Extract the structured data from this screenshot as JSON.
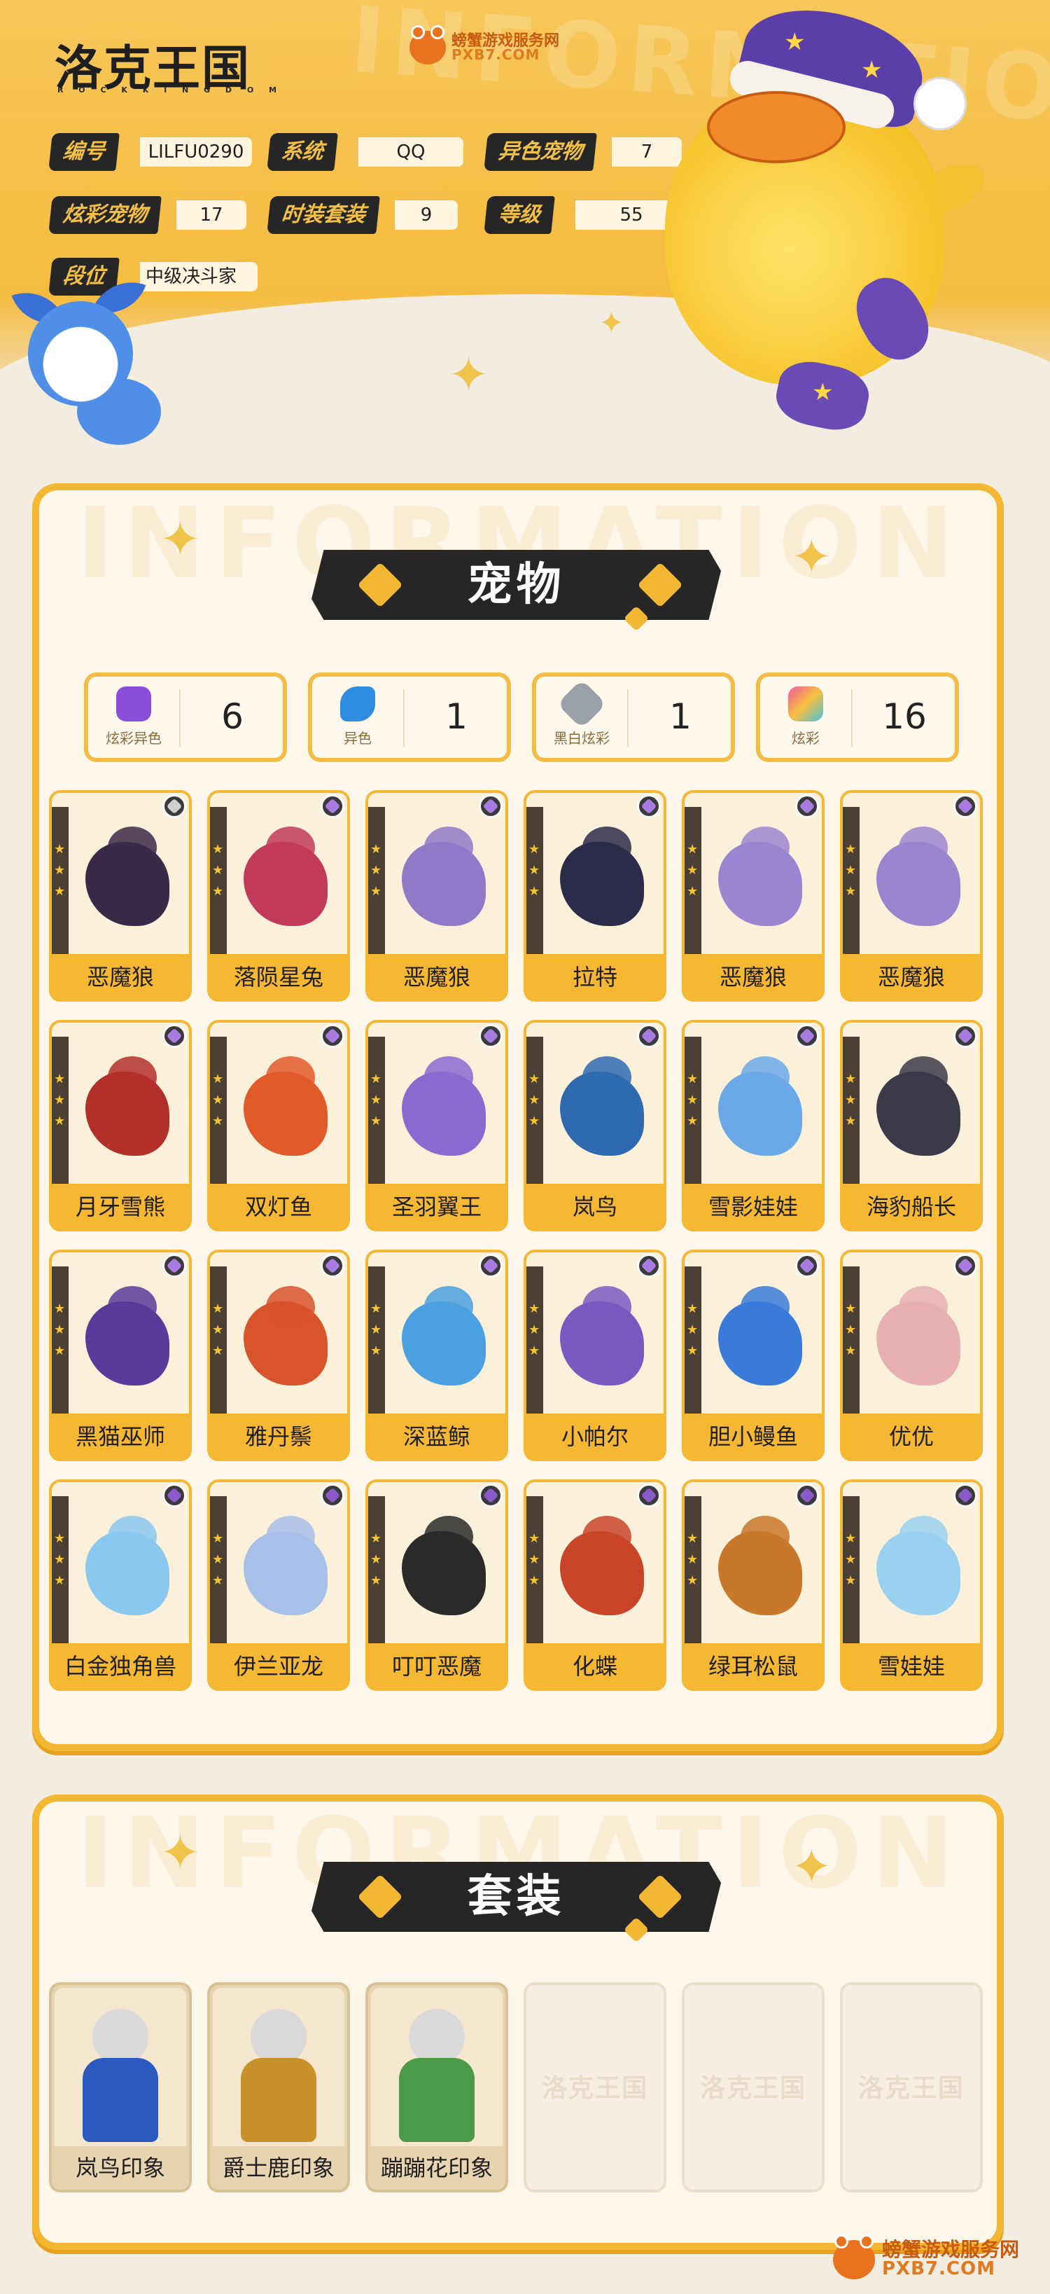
{
  "brand": {
    "logo": "洛克王国",
    "logo_sub": "R O C K K I N G D O M",
    "site_name": "螃蟹游戏服务网",
    "site_url": "PXB7.COM"
  },
  "watermark_text": "INFORMATION",
  "account": {
    "fields": [
      {
        "label": "编号",
        "value": "LILFU0290"
      },
      {
        "label": "系统",
        "value": "QQ"
      },
      {
        "label": "异色宠物",
        "value": "7"
      },
      {
        "label": "炫彩宠物",
        "value": "17"
      },
      {
        "label": "时装套装",
        "value": "9"
      },
      {
        "label": "等级",
        "value": "55"
      },
      {
        "label": "段位",
        "value": "中级决斗家"
      }
    ]
  },
  "pets_section": {
    "title": "宠物",
    "stats": [
      {
        "label": "炫彩异色",
        "value": "6",
        "icon": "rainbow-star-icon",
        "color": "#8a4fd8"
      },
      {
        "label": "异色",
        "value": "1",
        "icon": "blue-boomerang-icon",
        "color": "#2d8de0"
      },
      {
        "label": "黑白炫彩",
        "value": "1",
        "icon": "silver-diamond-icon",
        "color": "#9aa0a8"
      },
      {
        "label": "炫彩",
        "value": "16",
        "icon": "colorful-star-icon",
        "color": "#f05aa0"
      }
    ],
    "pets": [
      {
        "name": "恶魔狼",
        "color": "#3a2a4a",
        "arc": "#f3b733",
        "badge": "#cfcfcf"
      },
      {
        "name": "落陨星兔",
        "color": "#c23a5a",
        "arc": "#4a8fe0",
        "badge": "#a77be0"
      },
      {
        "name": "恶魔狼",
        "color": "#8f7ac8",
        "arc": "#4a8fe0",
        "badge": "#a77be0"
      },
      {
        "name": "拉特",
        "color": "#2b2b4a",
        "arc": "#4a8fe0",
        "badge": "#a77be0"
      },
      {
        "name": "恶魔狼",
        "color": "#9a86d0",
        "arc": "#4a8fe0",
        "badge": "#a77be0"
      },
      {
        "name": "恶魔狼",
        "color": "#9a86d0",
        "arc": "#4a8fe0",
        "badge": "#a77be0"
      },
      {
        "name": "月牙雪熊",
        "color": "#b3302a",
        "arc": "#4a8fe0",
        "badge": "#a77be0"
      },
      {
        "name": "双灯鱼",
        "color": "#e25a2a",
        "arc": "#4a8fe0",
        "badge": "#a77be0"
      },
      {
        "name": "圣羽翼王",
        "color": "#8a6ad0",
        "arc": "#f3b733",
        "badge": "#a77be0"
      },
      {
        "name": "岚鸟",
        "color": "#2f6ab0",
        "arc": "#5ad0c8",
        "badge": "#a77be0"
      },
      {
        "name": "雪影娃娃",
        "color": "#6aa8e8",
        "arc": "#5ad0c8",
        "badge": "#a77be0"
      },
      {
        "name": "海豹船长",
        "color": "#3a3a48",
        "arc": "#5ad0c8",
        "badge": "#a77be0"
      },
      {
        "name": "黑猫巫师",
        "color": "#5a3a9a",
        "arc": "#5ad0c8",
        "badge": "#a77be0"
      },
      {
        "name": "雅丹鬃",
        "color": "#d8542a",
        "arc": "#5ad0c8",
        "badge": "#a77be0"
      },
      {
        "name": "深蓝鲸",
        "color": "#4aa0e0",
        "arc": "#5ad0c8",
        "badge": "#a77be0"
      },
      {
        "name": "小帕尔",
        "color": "#7a5ac0",
        "arc": "#5ad0c8",
        "badge": "#a77be0"
      },
      {
        "name": "胆小鳗鱼",
        "color": "#3a7ad8",
        "arc": "#5ad0c8",
        "badge": "#a77be0"
      },
      {
        "name": "优优",
        "color": "#e8b0b0",
        "arc": "#5ad0c8",
        "badge": "#a77be0"
      },
      {
        "name": "白金独角兽",
        "color": "#8ac8f0",
        "arc": "#5ad0c8",
        "badge": "#8a5ac8"
      },
      {
        "name": "伊兰亚龙",
        "color": "#a8c0e8",
        "arc": "#5ad0c8",
        "badge": "#8a5ac8"
      },
      {
        "name": "叮叮恶魔",
        "color": "#2a2a2a",
        "arc": "#5ad0c8",
        "badge": "#8a5ac8"
      },
      {
        "name": "化蝶",
        "color": "#c8452a",
        "arc": "#5ad0c8",
        "badge": "#8a5ac8"
      },
      {
        "name": "绿耳松鼠",
        "color": "#c8782a",
        "arc": "#5ad0c8",
        "badge": "#8a5ac8"
      },
      {
        "name": "雪娃娃",
        "color": "#9ad0f0",
        "arc": "#5ad0c8",
        "badge": "#8a5ac8"
      }
    ]
  },
  "outfits_section": {
    "title": "套装",
    "outfits": [
      {
        "name": "岚鸟印象",
        "color": "#2a5ac0"
      },
      {
        "name": "爵士鹿印象",
        "color": "#c8922a"
      },
      {
        "name": "蹦蹦花印象",
        "color": "#4a9a4a"
      },
      {
        "name": "",
        "placeholder": "洛克王国"
      },
      {
        "name": "",
        "placeholder": "洛克王国"
      },
      {
        "name": "",
        "placeholder": "洛克王国"
      }
    ]
  },
  "colors": {
    "accent": "#f3b733",
    "dark": "#262626",
    "background": "#f3ece0"
  }
}
